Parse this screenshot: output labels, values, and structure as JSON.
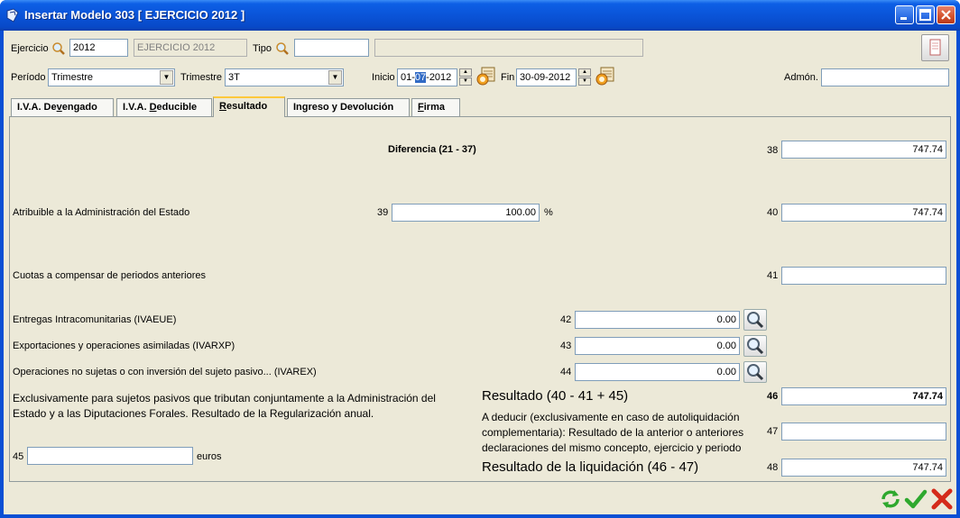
{
  "window": {
    "title": "Insertar Modelo 303 [ EJERCICIO 2012 ]"
  },
  "header": {
    "ejercicio_label": "Ejercicio",
    "ejercicio_value": "2012",
    "ejercicio_desc": "EJERCICIO 2012",
    "tipo_label": "Tipo",
    "tipo_value": "",
    "tipo_desc": "",
    "periodo_label": "Período",
    "periodo_value": "Trimestre",
    "trimestre_label": "Trimestre",
    "trimestre_value": "3T",
    "inicio_label": "Inicio",
    "inicio_prefix": "01-",
    "inicio_selected": "07",
    "inicio_suffix": "-2012",
    "fin_label": "Fin",
    "fin_value": "30-09-2012",
    "admon_label": "Admón.",
    "admon_value": ""
  },
  "tabs": [
    {
      "pre": "I.V.A. De",
      "u": "v",
      "post": "engado"
    },
    {
      "pre": "I.V.A. ",
      "u": "D",
      "post": "educible"
    },
    {
      "pre": "",
      "u": "R",
      "post": "esultado"
    },
    {
      "pre": "Ingreso y Devolución",
      "u": "",
      "post": ""
    },
    {
      "pre": "",
      "u": "F",
      "post": "irma"
    }
  ],
  "resultado": {
    "diferencia_label": "Diferencia (21 - 37)",
    "box38_num": "38",
    "box38_value": "747.74",
    "atribuible_label": "Atribuible a la Administración del Estado",
    "box39_num": "39",
    "box39_value": "100.00",
    "percent_sign": "%",
    "box40_num": "40",
    "box40_value": "747.74",
    "cuotas_label": "Cuotas a compensar de periodos anteriores",
    "box41_num": "41",
    "box41_value": "",
    "entregas_label": "Entregas Intracomunitarias (IVAEUE)",
    "box42_num": "42",
    "box42_value": "0.00",
    "export_label": "Exportaciones y operaciones asimiladas (IVARXP)",
    "box43_num": "43",
    "box43_value": "0.00",
    "nosujetas_label": "Operaciones no sujetas o con inversión del sujeto pasivo... (IVAREX)",
    "box44_num": "44",
    "box44_value": "0.00",
    "exclusivamente_line1": "Exclusivamente para sujetos pasivos que tributan conjuntamente a la Administración del",
    "exclusivamente_line2": "Estado y a las Diputaciones Forales. Resultado de la Regularización anual.",
    "box45_num": "45",
    "box45_value": "",
    "euros_label": "euros",
    "resultado_label": "Resultado (40 - 41 + 45)",
    "box46_num": "46",
    "box46_value": "747.74",
    "deducir_line1": "A deducir (exclusivamente en caso de autoliquidación",
    "deducir_line2": "complementaria): Resultado de la anterior o anteriores",
    "deducir_line3": "declaraciones del mismo concepto, ejercicio y periodo",
    "box47_num": "47",
    "box47_value": "",
    "liquidacion_label": "Resultado de la liquidación (46 - 47)",
    "box48_num": "48",
    "box48_value": "747.74"
  },
  "icons": {
    "search": "magnifier-icon",
    "calendar": "calendar-icon",
    "refresh": "refresh-icon",
    "accept": "checkmark-icon",
    "cancel": "close-icon"
  },
  "colors": {
    "title_bar": "#0a54d8",
    "client_bg": "#ece9d8",
    "tab_active_accent": "#ffc83c",
    "accept_green": "#2ea82e",
    "cancel_red": "#d42a1a"
  }
}
